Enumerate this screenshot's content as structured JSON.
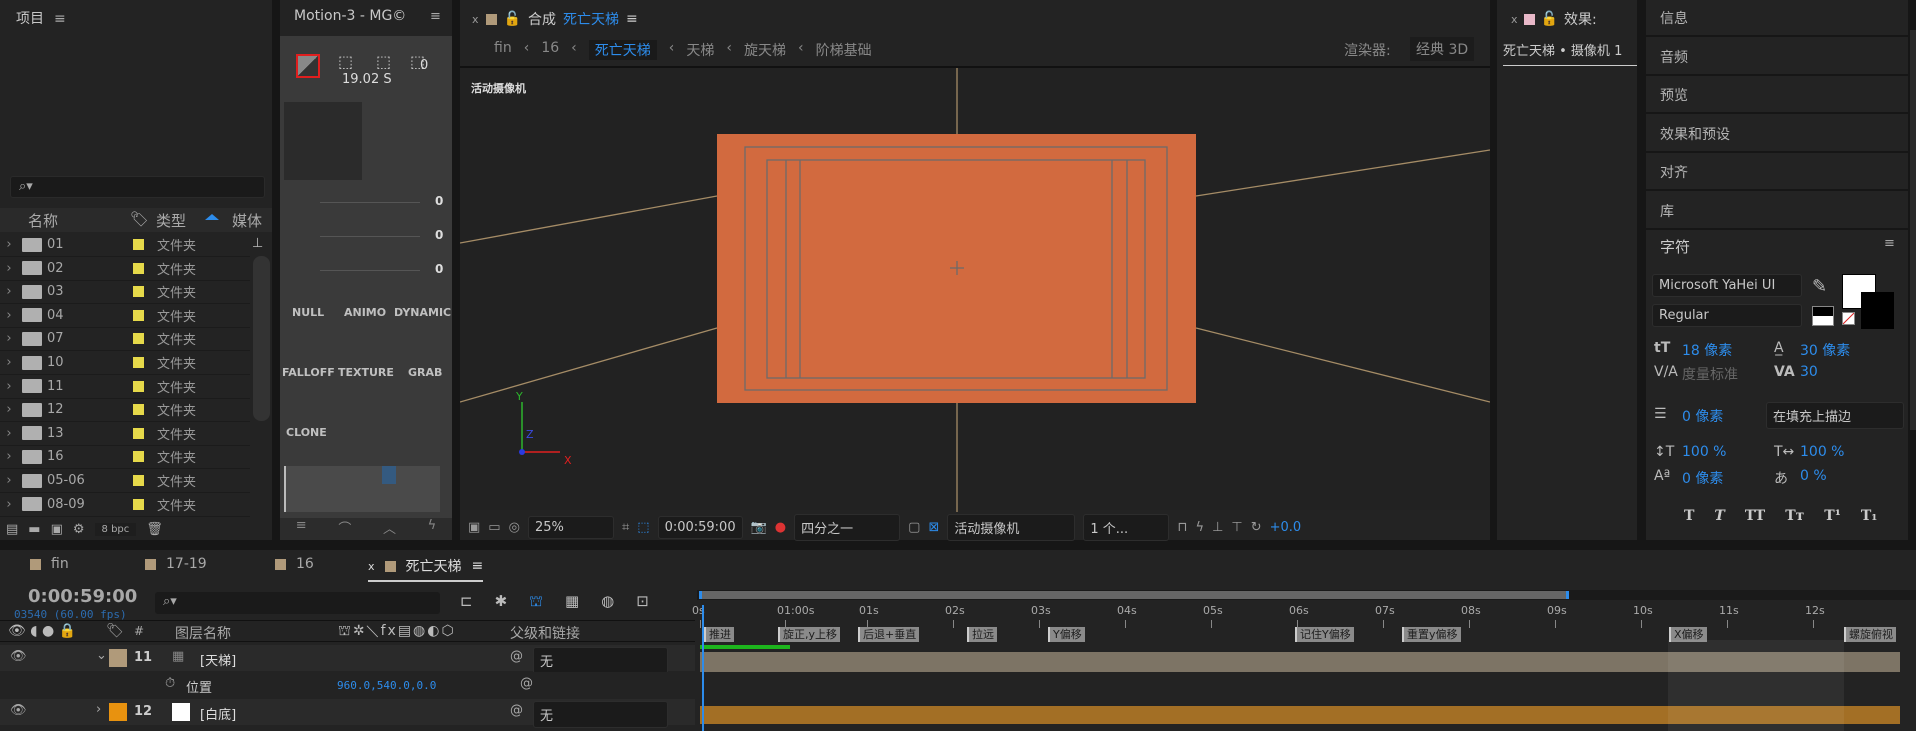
{
  "project": {
    "title": "项目",
    "search_placeholder": "",
    "columns": [
      "名称",
      "类型",
      "媒体"
    ],
    "items": [
      {
        "name": "01",
        "type": "文件夹"
      },
      {
        "name": "02",
        "type": "文件夹"
      },
      {
        "name": "03",
        "type": "文件夹"
      },
      {
        "name": "04",
        "type": "文件夹"
      },
      {
        "name": "07",
        "type": "文件夹"
      },
      {
        "name": "10",
        "type": "文件夹"
      },
      {
        "name": "11",
        "type": "文件夹"
      },
      {
        "name": "12",
        "type": "文件夹"
      },
      {
        "name": "13",
        "type": "文件夹"
      },
      {
        "name": "16",
        "type": "文件夹"
      },
      {
        "name": "05-06",
        "type": "文件夹"
      },
      {
        "name": "08-09",
        "type": "文件夹"
      }
    ],
    "bpc": "8 bpc",
    "folder_color": "#e6d94a"
  },
  "motion": {
    "title": "Motion-3 - MG©",
    "time": "19.02 S",
    "value": "0",
    "sliders": [
      "0",
      "0",
      "0"
    ],
    "buttons": [
      "NULL",
      "ANIMO",
      "DYNAMIC",
      "FALLOFF",
      "TEXTURE",
      "GRAB",
      "CLONE"
    ]
  },
  "comp": {
    "tab_prefix": "合成",
    "tab_name": "死亡天梯",
    "breadcrumbs": [
      "fin",
      "16",
      "死亡天梯",
      "天梯",
      "旋天梯",
      "阶梯基础"
    ],
    "renderer_label": "渲染器:",
    "renderer": "经典 3D",
    "camera_label": "活动摄像机",
    "toolbar": {
      "zoom": "25%",
      "time": "0:00:59:00",
      "resolution": "四分之一",
      "camera": "活动摄像机",
      "views": "1 个...",
      "exposure": "+0.0"
    },
    "bg_color": "#d26a3f"
  },
  "effects": {
    "title": "效果:",
    "subtitle": "死亡天梯 • 摄像机 1"
  },
  "right": {
    "items": [
      "信息",
      "音频",
      "预览",
      "效果和预设",
      "对齐",
      "库"
    ],
    "character": {
      "title": "字符",
      "font": "Microsoft YaHei UI",
      "style": "Regular",
      "size": "18 像素",
      "leading": "30 像素",
      "kerning": "度量标准",
      "tracking": "30",
      "stroke": "0 像素",
      "stroke_mode": "在填充上描边",
      "vscale": "100 %",
      "hscale": "100 %",
      "baseline": "0 像素",
      "tsume": "0 %",
      "styles": [
        "T",
        "T",
        "TT",
        "Tт",
        "T¹",
        "T₁"
      ]
    }
  },
  "timeline": {
    "tabs": [
      "fin",
      "17-19",
      "16",
      "死亡天梯"
    ],
    "time": "0:00:59:00",
    "frames": "03540 (60.00 fps)",
    "headers": {
      "name": "图层名称",
      "parent": "父级和链接",
      "num": "#"
    },
    "layers": [
      {
        "num": "11",
        "name": "[天梯]",
        "parent": "无",
        "color": "#b09a7a"
      },
      {
        "num": "12",
        "name": "[白底]",
        "parent": "无",
        "color": "#e8920f"
      }
    ],
    "property": {
      "name": "位置",
      "value": "960.0,540.0,0.0"
    },
    "ruler": [
      "0s",
      "01:00s",
      "01s",
      "02s",
      "03s",
      "04s",
      "05s",
      "06s",
      "07s",
      "08s",
      "09s",
      "10s",
      "11s",
      "12s"
    ],
    "markers": [
      "推进",
      "旋正,y上移",
      "后退+垂直",
      "拉远",
      "Y偏移",
      "记住Y偏移",
      "重置y偏移",
      "X偏移",
      "螺旋俯视"
    ]
  }
}
